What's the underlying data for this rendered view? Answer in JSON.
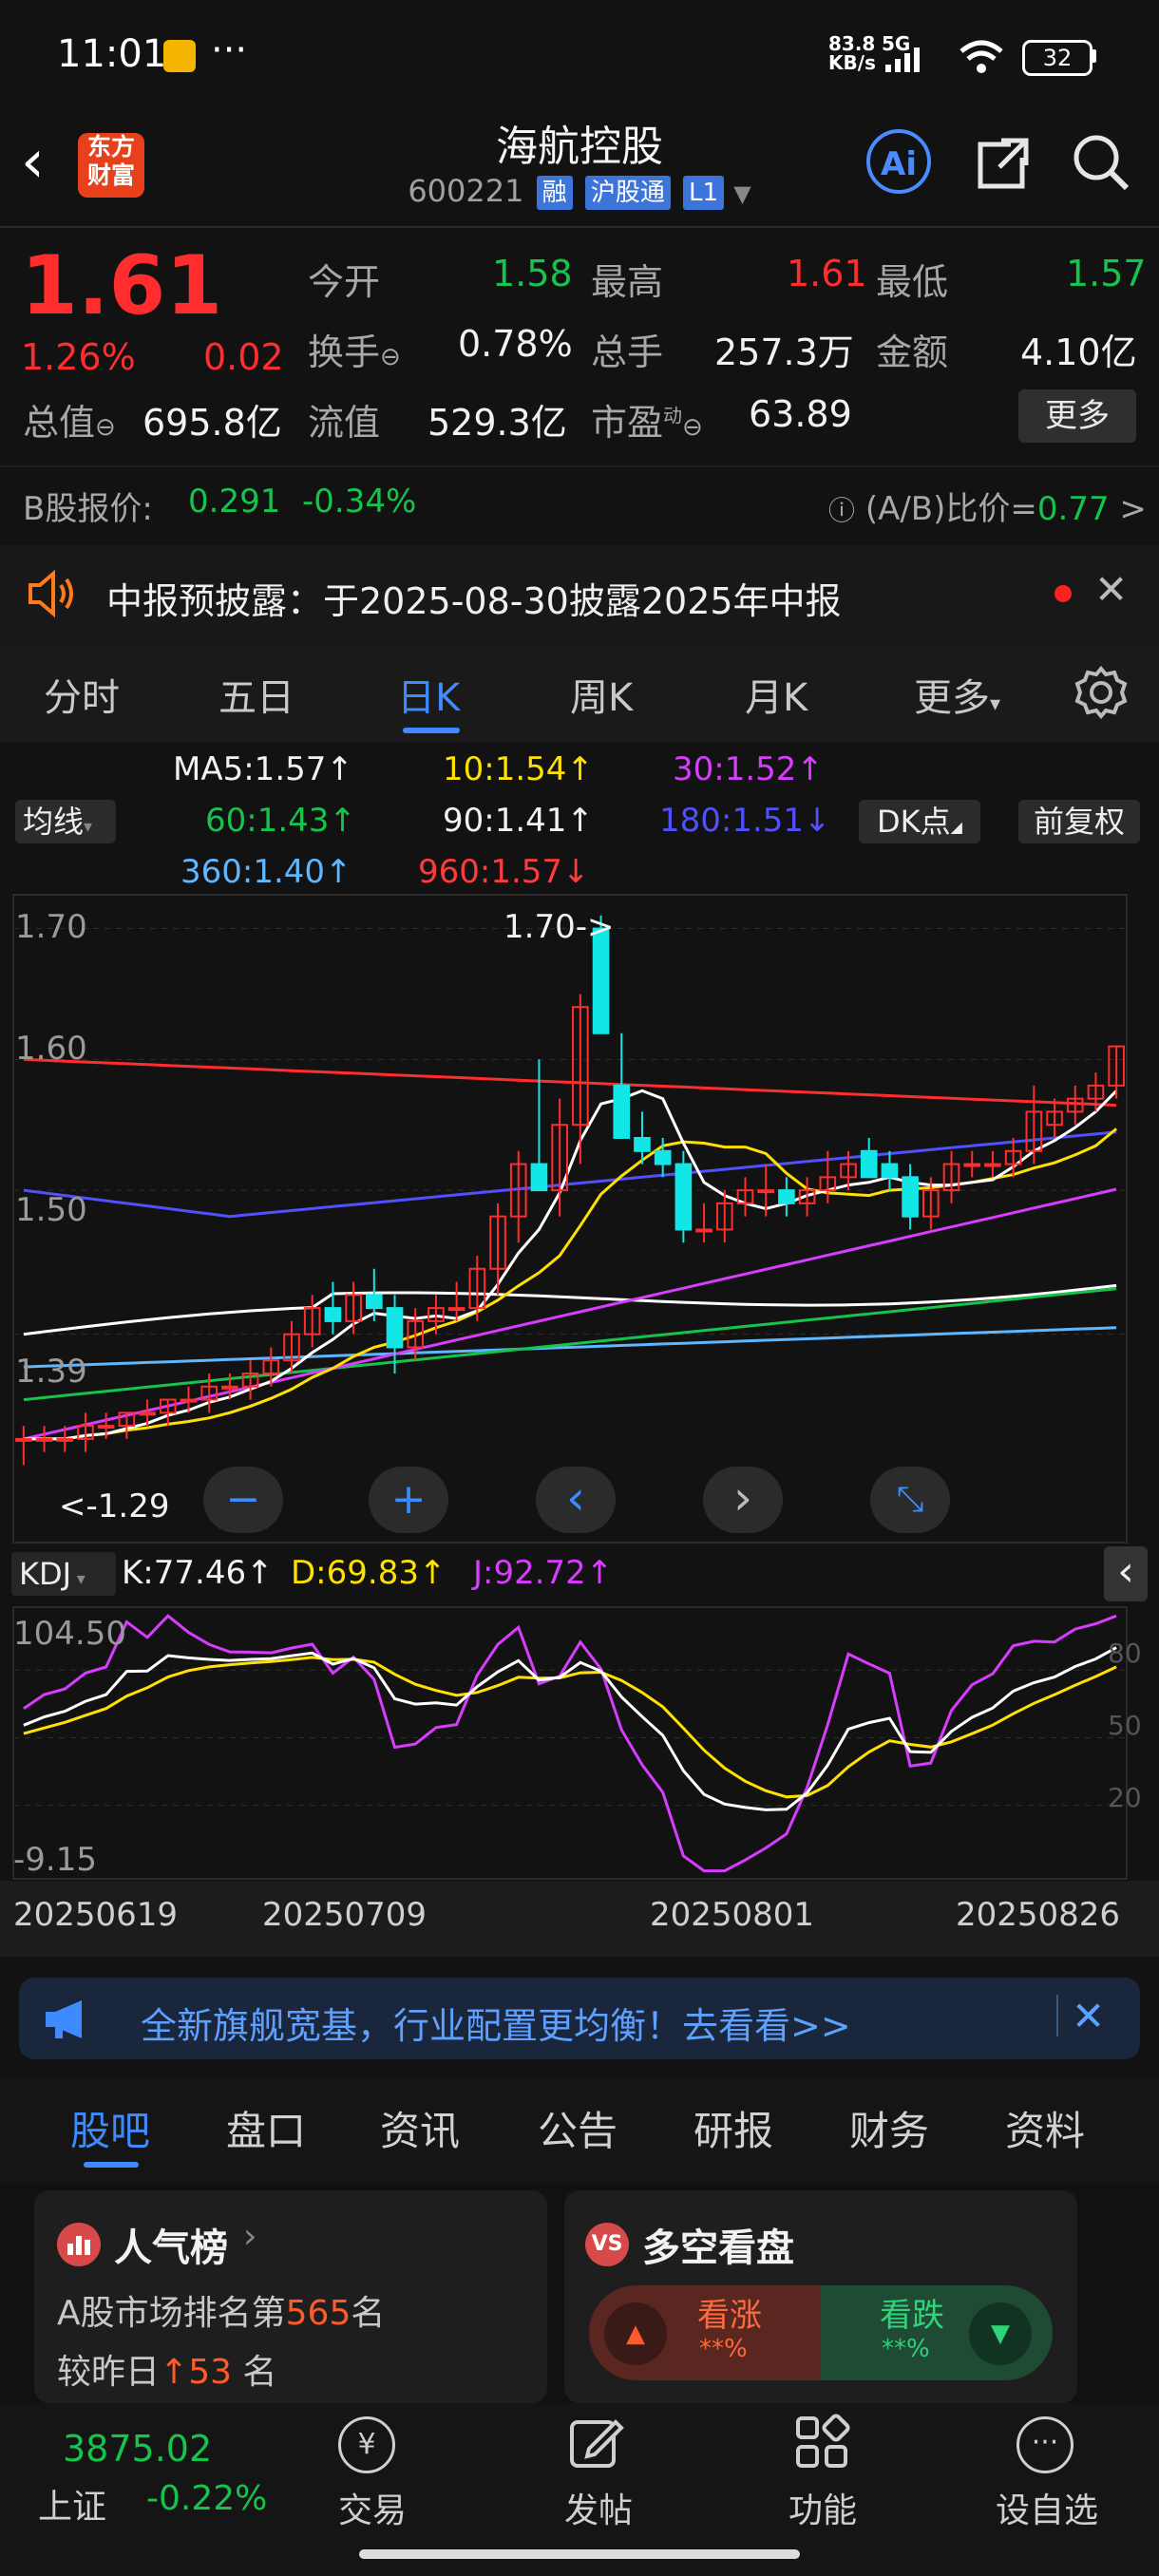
{
  "status": {
    "time": "11:01",
    "net_speed_top": "83.8",
    "net_speed_bottom": "KB/s",
    "network": "5G",
    "battery": "32"
  },
  "header": {
    "logo_line1": "东方",
    "logo_line2": "财富",
    "stock_name": "海航控股",
    "code": "600221",
    "badges": [
      "融",
      "沪股通",
      "L1"
    ]
  },
  "quote": {
    "price": "1.61",
    "change_pct": "1.26%",
    "change": "0.02",
    "open_label": "今开",
    "open": "1.58",
    "high_label": "最高",
    "high": "1.61",
    "low_label": "最低",
    "low": "1.57",
    "turnover_label": "换手",
    "turnover": "0.78%",
    "volume_label": "总手",
    "volume": "257.3万",
    "amount_label": "金额",
    "amount": "4.10亿",
    "mktcap_label": "总值",
    "mktcap": "695.8亿",
    "float_label": "流值",
    "float": "529.3亿",
    "pe_label": "市盈",
    "pe_sup": "动",
    "pe": "63.89",
    "more": "更多",
    "b_label": "B股报价:",
    "b_price": "0.291",
    "b_change": "-0.34%",
    "ab_label": "(A/B)比价=",
    "ab_value": "0.77",
    ">": ">"
  },
  "notice": {
    "text": "中报预披露：于2025-08-30披露2025年中报"
  },
  "ktabs": [
    "分时",
    "五日",
    "日K",
    "周K",
    "月K",
    "更多"
  ],
  "ktab_active": 2,
  "ma": {
    "selector": "均线",
    "ma5": "MA5:1.57↑",
    "ma10": "10:1.54↑",
    "ma30": "30:1.52↑",
    "ma60": "60:1.43↑",
    "ma90": "90:1.41↑",
    "ma180": "180:1.51↓",
    "ma360": "360:1.40↑",
    "ma960": "960:1.57↓",
    "dk": "DK点",
    "fq": "前复权"
  },
  "chart_data": {
    "type": "candlestick",
    "y_ticks": [
      "1.70",
      "1.60",
      "1.50",
      "1.39"
    ],
    "max_label": "1.70->",
    "min_label": "<-1.29",
    "x_ticks": [
      "20250619",
      "20250709",
      "20250801",
      "20250826"
    ],
    "ohlc": [
      [
        1.31,
        1.32,
        1.29,
        1.31
      ],
      [
        1.31,
        1.32,
        1.3,
        1.31
      ],
      [
        1.31,
        1.32,
        1.3,
        1.31
      ],
      [
        1.31,
        1.33,
        1.3,
        1.32
      ],
      [
        1.32,
        1.33,
        1.31,
        1.32
      ],
      [
        1.32,
        1.33,
        1.31,
        1.33
      ],
      [
        1.33,
        1.34,
        1.32,
        1.33
      ],
      [
        1.33,
        1.34,
        1.32,
        1.34
      ],
      [
        1.34,
        1.35,
        1.33,
        1.34
      ],
      [
        1.34,
        1.36,
        1.33,
        1.35
      ],
      [
        1.35,
        1.36,
        1.34,
        1.35
      ],
      [
        1.35,
        1.37,
        1.34,
        1.36
      ],
      [
        1.36,
        1.38,
        1.35,
        1.37
      ],
      [
        1.37,
        1.4,
        1.36,
        1.39
      ],
      [
        1.39,
        1.42,
        1.38,
        1.41
      ],
      [
        1.41,
        1.43,
        1.39,
        1.4
      ],
      [
        1.4,
        1.43,
        1.39,
        1.42
      ],
      [
        1.42,
        1.44,
        1.4,
        1.41
      ],
      [
        1.41,
        1.42,
        1.36,
        1.38
      ],
      [
        1.38,
        1.41,
        1.37,
        1.4
      ],
      [
        1.4,
        1.42,
        1.39,
        1.41
      ],
      [
        1.41,
        1.43,
        1.4,
        1.41
      ],
      [
        1.41,
        1.45,
        1.4,
        1.44
      ],
      [
        1.44,
        1.49,
        1.42,
        1.48
      ],
      [
        1.48,
        1.53,
        1.46,
        1.52
      ],
      [
        1.52,
        1.6,
        1.5,
        1.5
      ],
      [
        1.5,
        1.57,
        1.48,
        1.55
      ],
      [
        1.55,
        1.65,
        1.52,
        1.64
      ],
      [
        1.7,
        1.71,
        1.62,
        1.62
      ],
      [
        1.58,
        1.62,
        1.54,
        1.54
      ],
      [
        1.54,
        1.56,
        1.52,
        1.53
      ],
      [
        1.53,
        1.54,
        1.51,
        1.52
      ],
      [
        1.52,
        1.53,
        1.46,
        1.47
      ],
      [
        1.47,
        1.49,
        1.46,
        1.47
      ],
      [
        1.47,
        1.5,
        1.46,
        1.49
      ],
      [
        1.49,
        1.51,
        1.48,
        1.5
      ],
      [
        1.5,
        1.52,
        1.48,
        1.5
      ],
      [
        1.5,
        1.51,
        1.48,
        1.49
      ],
      [
        1.49,
        1.51,
        1.48,
        1.5
      ],
      [
        1.5,
        1.53,
        1.49,
        1.51
      ],
      [
        1.51,
        1.53,
        1.5,
        1.52
      ],
      [
        1.53,
        1.54,
        1.51,
        1.51
      ],
      [
        1.52,
        1.53,
        1.5,
        1.51
      ],
      [
        1.51,
        1.52,
        1.47,
        1.48
      ],
      [
        1.48,
        1.51,
        1.47,
        1.5
      ],
      [
        1.5,
        1.53,
        1.49,
        1.52
      ],
      [
        1.52,
        1.53,
        1.51,
        1.52
      ],
      [
        1.52,
        1.53,
        1.51,
        1.52
      ],
      [
        1.52,
        1.54,
        1.51,
        1.53
      ],
      [
        1.53,
        1.58,
        1.52,
        1.56
      ],
      [
        1.55,
        1.57,
        1.54,
        1.56
      ],
      [
        1.56,
        1.58,
        1.55,
        1.57
      ],
      [
        1.57,
        1.59,
        1.56,
        1.58
      ],
      [
        1.58,
        1.61,
        1.57,
        1.61
      ]
    ],
    "kdj": {
      "label": "KDJ",
      "k": "K:77.46↑",
      "d": "D:69.83↑",
      "j": "J:92.72↑",
      "top": "104.50",
      "bottom": "-9.15",
      "levels": [
        "80",
        "50",
        "20"
      ]
    }
  },
  "banner": {
    "text": "全新旗舰宽基，行业配置更均衡！去看看>>"
  },
  "bottom_tabs": [
    "股吧",
    "盘口",
    "资讯",
    "公告",
    "研报",
    "财务",
    "资料"
  ],
  "popularity": {
    "title": "人气榜",
    "line1_pre": "A股市场排名第",
    "rank": "565",
    "line1_post": "名",
    "line2_pre": "较昨日",
    "change": "53",
    "line2_post": "名"
  },
  "sentiment": {
    "title": "多空看盘",
    "up": "看涨",
    "down": "看跌",
    "up_pct": "**%",
    "down_pct": "**%"
  },
  "nav": {
    "index_value": "3875.02",
    "index_name": "上证",
    "index_change": "-0.22%",
    "trade": "交易",
    "post": "发帖",
    "func": "功能",
    "fav": "设自选"
  },
  "colors": {
    "up": "#ff2d2d",
    "down": "#13e6e6",
    "ma5": "#ffffff",
    "ma10": "#ffe000",
    "ma30": "#d83cff",
    "ma60": "#16c34c",
    "ma90": "#ffffff",
    "ma180": "#5050ff",
    "ma360": "#5fb7ff",
    "ma960": "#ff2d2d"
  }
}
